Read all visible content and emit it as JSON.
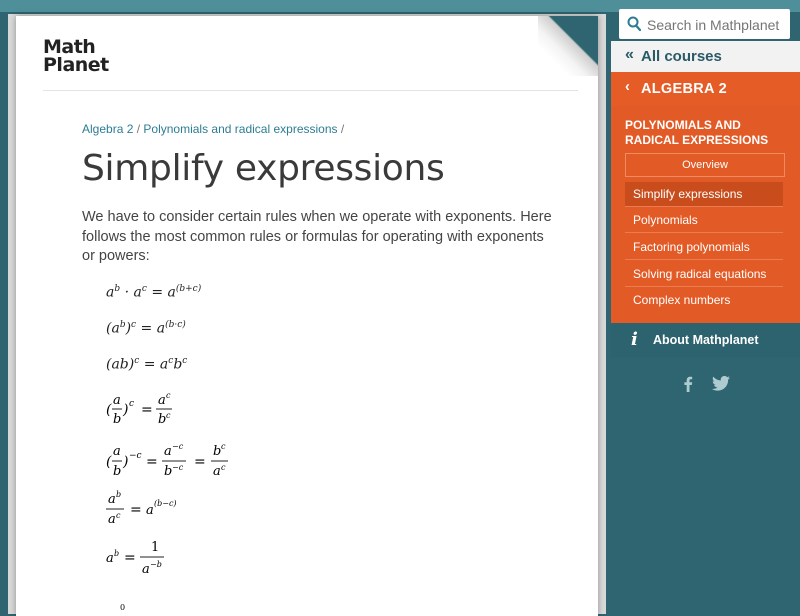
{
  "logo": {
    "line1": "Math",
    "line2": "Planet"
  },
  "breadcrumb": {
    "item1": "Algebra 2",
    "sep": "/",
    "item2": "Polynomials and radical expressions"
  },
  "page": {
    "title": "Simplify expressions",
    "intro": "We have to consider certain rules when we operate with exponents. Here follows the most common rules or formulas for operating with exponents or powers:"
  },
  "search": {
    "placeholder": "Search in Mathplanet"
  },
  "nav": {
    "all_courses": "All courses",
    "course": "ALGEBRA 2",
    "section_title": "POLYNOMIALS AND RADICAL EXPRESSIONS",
    "overview": "Overview",
    "items": [
      {
        "label": "Simplify expressions"
      },
      {
        "label": "Polynomials"
      },
      {
        "label": "Factoring polynomials"
      },
      {
        "label": "Solving radical equations"
      },
      {
        "label": "Complex numbers"
      }
    ],
    "about": "About Mathplanet"
  },
  "social": {
    "facebook_icon": "f",
    "twitter_icon": "twitter-bird"
  },
  "colors": {
    "accent": "#e55c26",
    "sidebar": "#2f6570",
    "link": "#2c7d93"
  }
}
